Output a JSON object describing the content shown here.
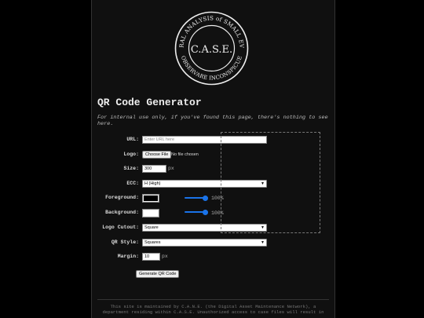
{
  "logo": {
    "ring_top": "CENTRAL ANALYSIS of SMALL EVENTS",
    "ring_bottom": "OBSERVARE INCONSPICUE",
    "center": "C.A.S.E."
  },
  "page_title": "QR Code Generator",
  "note": "For internal use only, if you've found this page, there's nothing to see here.",
  "form": {
    "url": {
      "label": "URL:",
      "placeholder": "Enter URL here"
    },
    "logo": {
      "label": "Logo:",
      "button": "Choose File",
      "status": "No file chosen"
    },
    "size": {
      "label": "Size:",
      "value": "300",
      "unit": "px"
    },
    "ecc": {
      "label": "ECC:",
      "value": "H (High)"
    },
    "foreground": {
      "label": "Foreground:",
      "color": "#000000",
      "opacity_text": "100%",
      "opacity": 1.0
    },
    "background": {
      "label": "Background:",
      "color": "#ffffff",
      "opacity_text": "100%",
      "opacity": 1.0
    },
    "logo_cutout": {
      "label": "Logo Cutout:",
      "value": "Square"
    },
    "qr_style": {
      "label": "QR Style:",
      "value": "Squares"
    },
    "margin": {
      "label": "Margin:",
      "value": "10",
      "unit": "px"
    },
    "submit": "Generate QR Code"
  },
  "footer": "This site is maintained by C.A.N.E. (the Digital Asset Maintenance Network), a department residing within C.A.S.E. Unauthorized access to case files will result in"
}
